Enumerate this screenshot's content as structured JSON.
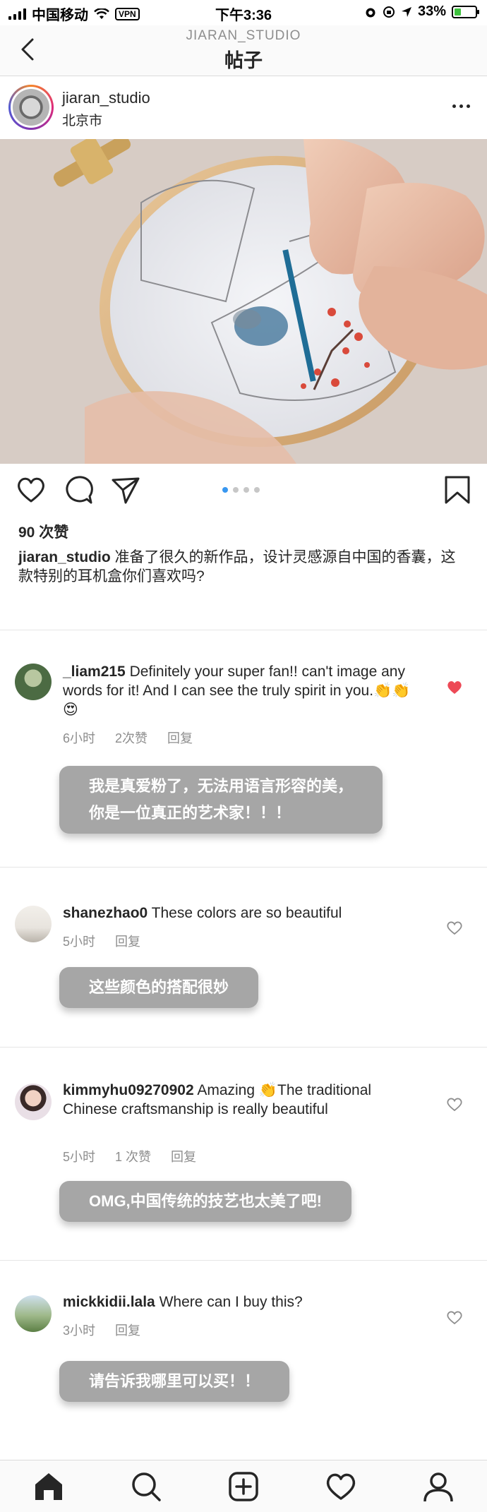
{
  "status_bar": {
    "carrier": "中国移动",
    "vpn": "VPN",
    "time": "下午3:36",
    "battery": "33%",
    "battery_level": 0.33
  },
  "header": {
    "subtitle": "JIARAN_STUDIO",
    "title": "帖子"
  },
  "post": {
    "username": "jiaran_studio",
    "location": "北京市",
    "likes": "90 次赞",
    "caption_user": "jiaran_studio",
    "caption_text": " 准备了很久的新作品，设计灵感源自中国的香囊，这款特别的耳机盒你们喜欢吗?",
    "carousel_count": 4,
    "carousel_active": 1
  },
  "comments": [
    {
      "username": "_liam215",
      "text": " Definitely your super fan!! can't image any words for it! And I can see the truly spirit in you.👏👏😍",
      "time": "6小时",
      "likes": "2次赞",
      "reply": "回复",
      "liked": true,
      "translation_line1": "我是真爱粉了，无法用语言形容的美，",
      "translation_line2": "你是一位真正的艺术家！！！"
    },
    {
      "username": "shanezhao0",
      "text": " These colors are so beautiful",
      "time": "5小时",
      "reply": "回复",
      "liked": false,
      "translation_line1": "这些颜色的搭配很妙"
    },
    {
      "username": "kimmyhu09270902",
      "text": " Amazing 👏The traditional Chinese craftsmanship is really beautiful",
      "time": "5小时",
      "likes": "1 次赞",
      "reply": "回复",
      "liked": false,
      "translation_line1": "OMG,中国传统的技艺也太美了吧!"
    },
    {
      "username": "mickkidii.lala",
      "text": " Where can I buy this?",
      "time": "3小时",
      "reply": "回复",
      "liked": false,
      "translation_line1": "请告诉我哪里可以买！！"
    }
  ],
  "colors": {
    "accent_blue": "#3897f0",
    "heart_red": "#ed4956",
    "bubble_gray": "#a6a6a6"
  }
}
